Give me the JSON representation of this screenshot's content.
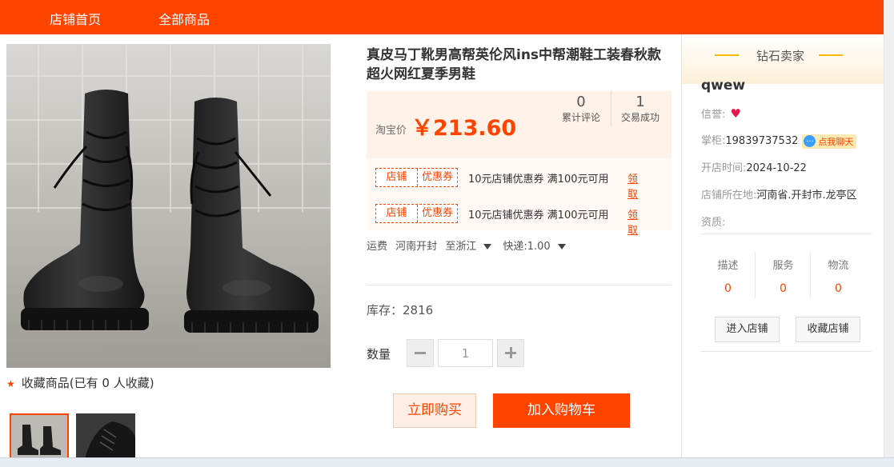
{
  "nav": {
    "home": "店铺首页",
    "all": "全部商品"
  },
  "product": {
    "title": "真皮马丁靴男高帮英伦风ins中帮潮鞋工装春秋款超火网红夏季男鞋",
    "price_label": "淘宝价",
    "price": "￥213.60",
    "reviews_count": "0",
    "reviews_label": "累计评论",
    "deals_count": "1",
    "deals_label": "交易成功",
    "coupons": [
      {
        "tag_a": "店铺",
        "tag_b": "优惠券",
        "desc": "10元店铺优惠券 满100元可用",
        "action": "领取"
      },
      {
        "tag_a": "店铺",
        "tag_b": "优惠券",
        "desc": "10元店铺优惠券 满100元可用",
        "action": "领取"
      }
    ],
    "shipping": {
      "label": "运费",
      "from": "河南开封",
      "to": "至浙江",
      "express": "快递:1.00"
    },
    "stock": "库存：2816",
    "qty_label": "数量",
    "qty_value": "1",
    "buy_label": "立即购买",
    "cart_label": "加入购物车",
    "favorite_text": "收藏商品(已有 0 人收藏)"
  },
  "seller": {
    "grade": "钻石卖家",
    "name": "qwew",
    "credit_label": "信誉:",
    "owner_label": "掌柜:",
    "owner_value": "19839737532",
    "chat_label": "点我聊天",
    "open_label": "开店时间:",
    "open_value": "2024-10-22",
    "location_label": "店铺所在地:",
    "location_value": "河南省.开封市.龙亭区",
    "qualification_label": "资质:",
    "scores": [
      {
        "label": "描述",
        "value": "0"
      },
      {
        "label": "服务",
        "value": "0"
      },
      {
        "label": "物流",
        "value": "0"
      }
    ],
    "enter_label": "进入店铺",
    "collect_label": "收藏店铺"
  },
  "colors": {
    "accent": "#ff4400",
    "price_bg": "#fff2e8",
    "seller_header": "#fdf0d8"
  },
  "icons": {
    "favorite": "star-icon",
    "credit": "heart-icon",
    "chat": "chat-bubble-icon",
    "dropdown": "triangle-down-icon"
  }
}
